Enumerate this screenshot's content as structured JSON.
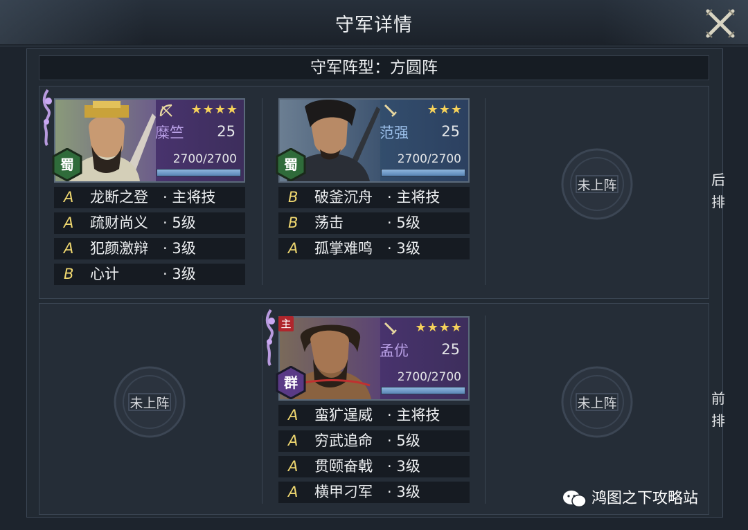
{
  "header": {
    "title": "守军详情"
  },
  "formation": {
    "text": "守军阵型：方圆阵"
  },
  "rows": {
    "back": [
      "后",
      "排"
    ],
    "front": [
      "前",
      "排"
    ]
  },
  "empty_slot_label": "未上阵",
  "heroes": [
    {
      "name": "糜竺",
      "level": "25",
      "stars": "★★★★",
      "hp": "2700/2700",
      "hp_fraction": 1.0,
      "faction": "蜀",
      "weapon_icon": "bow-icon",
      "theme": "purple",
      "skills": [
        {
          "grade": "A",
          "name": "龙断之登",
          "level": "· 主将技"
        },
        {
          "grade": "A",
          "name": "疏财尚义",
          "level": "· 5级"
        },
        {
          "grade": "A",
          "name": "犯颜激辩",
          "level": "· 3级"
        },
        {
          "grade": "B",
          "name": "心计",
          "level": "· 3级"
        }
      ]
    },
    {
      "name": "范强",
      "level": "25",
      "stars": "★★★",
      "hp": "2700/2700",
      "hp_fraction": 1.0,
      "faction": "蜀",
      "weapon_icon": "sword-icon",
      "theme": "blue",
      "skills": [
        {
          "grade": "B",
          "name": "破釜沉舟",
          "level": "· 主将技"
        },
        {
          "grade": "B",
          "name": "荡击",
          "level": "· 5级"
        },
        {
          "grade": "A",
          "name": "孤掌难鸣",
          "level": "· 3级"
        }
      ]
    },
    {
      "name": "孟优",
      "level": "25",
      "stars": "★★★★",
      "hp": "2700/2700",
      "hp_fraction": 1.0,
      "faction": "群",
      "weapon_icon": "sword-icon",
      "theme": "purple",
      "main_tag": "主",
      "skills": [
        {
          "grade": "A",
          "name": "蛮犷逞威",
          "level": "· 主将技"
        },
        {
          "grade": "A",
          "name": "穷武追命",
          "level": "· 5级"
        },
        {
          "grade": "A",
          "name": "贯颐奋戟",
          "level": "· 3级"
        },
        {
          "grade": "A",
          "name": "横甲刁军",
          "level": "· 3级"
        }
      ]
    }
  ],
  "watermark": "鸿图之下攻略站",
  "colors": {
    "star": "#f6d25a",
    "skill_grade": "#f0d870",
    "main_tag": "#b0262c"
  }
}
